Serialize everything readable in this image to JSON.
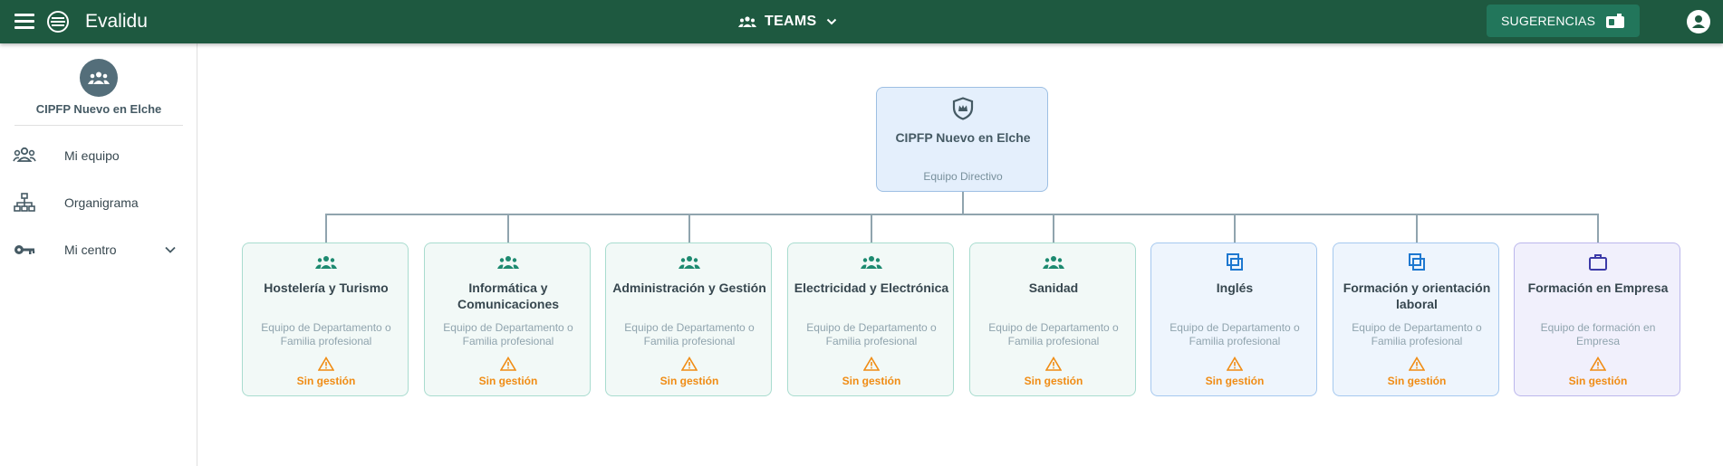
{
  "header": {
    "app_title": "Evalidu",
    "teams_label": "TEAMS",
    "suggestions_label": "SUGERENCIAS",
    "bar_color": "#1e5940",
    "button_color": "#22765b"
  },
  "sidebar": {
    "org_name": "CIPFP Nuevo en Elche",
    "items": [
      {
        "label": "Mi equipo",
        "icon": "group-icon"
      },
      {
        "label": "Organigrama",
        "icon": "sitemap-icon"
      },
      {
        "label": "Mi centro",
        "icon": "key-icon",
        "expandable": true
      }
    ]
  },
  "orgchart": {
    "root": {
      "name": "CIPFP Nuevo en Elche",
      "subtitle": "Equipo Directivo",
      "icon": "shield-crown-icon"
    },
    "children": [
      {
        "name": "Hostelería y Turismo",
        "subtitle": "Equipo de Departamento o Familia profesional",
        "status": "Sin gestión",
        "kind": "team",
        "icon": "group-icon"
      },
      {
        "name": "Informática y Comunicaciones",
        "subtitle": "Equipo de Departamento o Familia profesional",
        "status": "Sin gestión",
        "kind": "team",
        "icon": "group-icon"
      },
      {
        "name": "Administración y Gestión",
        "subtitle": "Equipo de Departamento o Familia profesional",
        "status": "Sin gestión",
        "kind": "team",
        "icon": "group-icon"
      },
      {
        "name": "Electricidad y Electrónica",
        "subtitle": "Equipo de Departamento o Familia profesional",
        "status": "Sin gestión",
        "kind": "team",
        "icon": "group-icon"
      },
      {
        "name": "Sanidad",
        "subtitle": "Equipo de Departamento o Familia profesional",
        "status": "Sin gestión",
        "kind": "team",
        "icon": "group-icon"
      },
      {
        "name": "Inglés",
        "subtitle": "Equipo de Departamento o Familia profesional",
        "status": "Sin gestión",
        "kind": "subject",
        "icon": "overlap-squares-icon"
      },
      {
        "name": "Formación y orientación laboral",
        "subtitle": "Equipo de Departamento o Familia profesional",
        "status": "Sin gestión",
        "kind": "subject",
        "icon": "overlap-squares-icon"
      },
      {
        "name": "Formación en Empresa",
        "subtitle": "Equipo de formación en Empresa",
        "status": "Sin gestión",
        "kind": "company",
        "icon": "briefcase-icon"
      }
    ],
    "status_color": "#f08c14"
  }
}
